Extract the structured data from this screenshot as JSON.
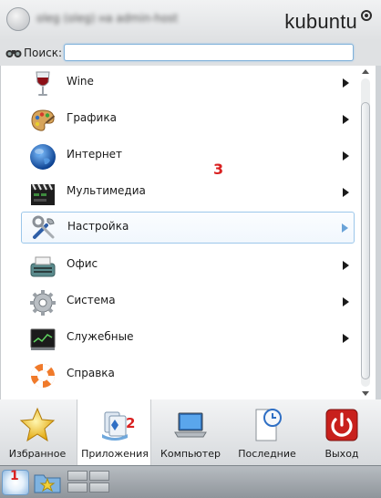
{
  "header": {
    "user_name": "oleg (oleg) на admin-host",
    "logo_text": "kubuntu"
  },
  "search": {
    "label": "Поиск:",
    "value": "",
    "placeholder": ""
  },
  "menu": {
    "items": [
      {
        "label": "Wine",
        "icon": "wine-glass-icon"
      },
      {
        "label": "Графика",
        "icon": "palette-icon"
      },
      {
        "label": "Интернет",
        "icon": "globe-icon"
      },
      {
        "label": "Мультимедиа",
        "icon": "clapperboard-icon"
      },
      {
        "label": "Настройка",
        "icon": "tools-icon"
      },
      {
        "label": "Офис",
        "icon": "typewriter-icon"
      },
      {
        "label": "Система",
        "icon": "gear-icon"
      },
      {
        "label": "Служебные",
        "icon": "monitor-icon"
      },
      {
        "label": "Справка",
        "icon": "lifebuoy-icon"
      }
    ],
    "hovered_index": 4
  },
  "annotations": {
    "one": "1",
    "two": "2",
    "three": "3"
  },
  "tabs": [
    {
      "label": "Избранное",
      "icon": "star-icon"
    },
    {
      "label": "Приложения",
      "icon": "applications-icon"
    },
    {
      "label": "Компьютер",
      "icon": "laptop-icon"
    },
    {
      "label": "Последние",
      "icon": "recent-document-icon"
    },
    {
      "label": "Выход",
      "icon": "power-icon"
    }
  ],
  "active_tab": 1,
  "colors": {
    "accent": "#9cc7ea",
    "annotation_red": "#d92121",
    "exit_red": "#c8201c"
  }
}
